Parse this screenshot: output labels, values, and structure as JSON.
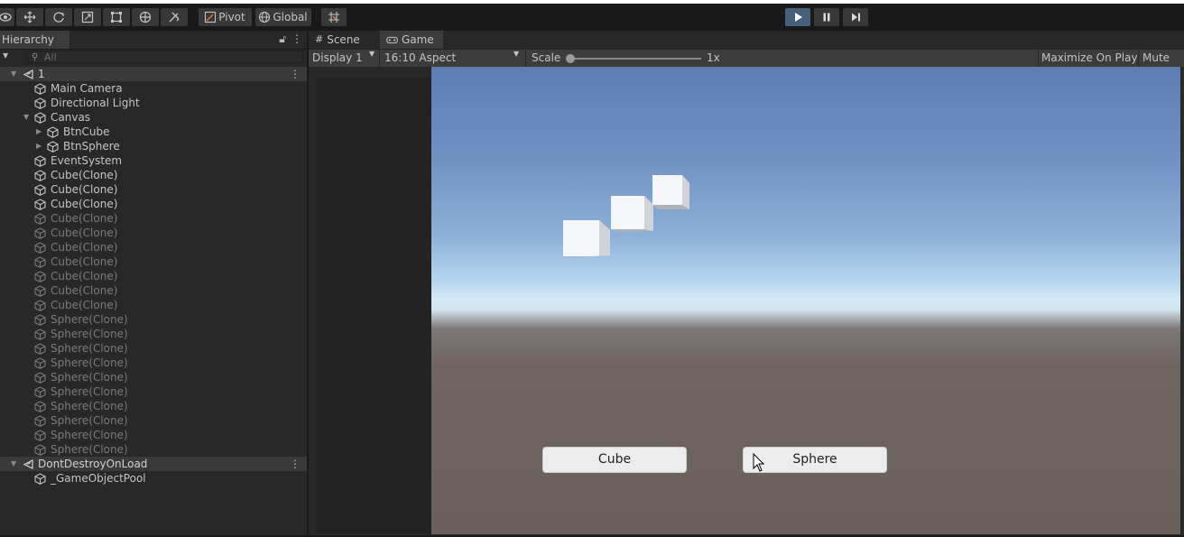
{
  "toolbar": {
    "pivot_label": "Pivot",
    "global_label": "Global",
    "tools": [
      "view-tool",
      "move-tool",
      "rotate-tool",
      "scale-tool",
      "rect-tool",
      "transform-tool",
      "custom-tool"
    ],
    "play_active": true
  },
  "hierarchy": {
    "tab_label": "Hierarchy",
    "search_placeholder": "All",
    "items": [
      {
        "label": "1",
        "type": "scene",
        "depth": 0
      },
      {
        "label": "Main Camera",
        "type": "object",
        "depth": 1
      },
      {
        "label": "Directional Light",
        "type": "object",
        "depth": 1
      },
      {
        "label": "Canvas",
        "type": "object",
        "depth": 1,
        "expanded": true
      },
      {
        "label": "BtnCube",
        "type": "object",
        "depth": 2,
        "collapsed": true
      },
      {
        "label": "BtnSphere",
        "type": "object",
        "depth": 2,
        "collapsed": true
      },
      {
        "label": "EventSystem",
        "type": "object",
        "depth": 1
      },
      {
        "label": "Cube(Clone)",
        "type": "object",
        "depth": 1
      },
      {
        "label": "Cube(Clone)",
        "type": "object",
        "depth": 1
      },
      {
        "label": "Cube(Clone)",
        "type": "object",
        "depth": 1
      },
      {
        "label": "Cube(Clone)",
        "type": "object",
        "depth": 1,
        "inactive": true
      },
      {
        "label": "Cube(Clone)",
        "type": "object",
        "depth": 1,
        "inactive": true
      },
      {
        "label": "Cube(Clone)",
        "type": "object",
        "depth": 1,
        "inactive": true
      },
      {
        "label": "Cube(Clone)",
        "type": "object",
        "depth": 1,
        "inactive": true
      },
      {
        "label": "Cube(Clone)",
        "type": "object",
        "depth": 1,
        "inactive": true
      },
      {
        "label": "Cube(Clone)",
        "type": "object",
        "depth": 1,
        "inactive": true
      },
      {
        "label": "Cube(Clone)",
        "type": "object",
        "depth": 1,
        "inactive": true
      },
      {
        "label": "Sphere(Clone)",
        "type": "object",
        "depth": 1,
        "inactive": true
      },
      {
        "label": "Sphere(Clone)",
        "type": "object",
        "depth": 1,
        "inactive": true
      },
      {
        "label": "Sphere(Clone)",
        "type": "object",
        "depth": 1,
        "inactive": true
      },
      {
        "label": "Sphere(Clone)",
        "type": "object",
        "depth": 1,
        "inactive": true
      },
      {
        "label": "Sphere(Clone)",
        "type": "object",
        "depth": 1,
        "inactive": true
      },
      {
        "label": "Sphere(Clone)",
        "type": "object",
        "depth": 1,
        "inactive": true
      },
      {
        "label": "Sphere(Clone)",
        "type": "object",
        "depth": 1,
        "inactive": true
      },
      {
        "label": "Sphere(Clone)",
        "type": "object",
        "depth": 1,
        "inactive": true
      },
      {
        "label": "Sphere(Clone)",
        "type": "object",
        "depth": 1,
        "inactive": true
      },
      {
        "label": "Sphere(Clone)",
        "type": "object",
        "depth": 1,
        "inactive": true
      },
      {
        "label": "DontDestroyOnLoad",
        "type": "scene",
        "depth": 0
      },
      {
        "label": "_GameObjectPool",
        "type": "object",
        "depth": 1
      }
    ]
  },
  "game": {
    "tabs": [
      {
        "label": "Scene",
        "icon": "grid-icon"
      },
      {
        "label": "Game",
        "icon": "gamepad-icon"
      }
    ],
    "display": "Display 1",
    "aspect": "16:10 Aspect",
    "scale_label": "Scale",
    "scale_value": "1x",
    "maximize_label": "Maximize On Play",
    "mute_label": "Mute Au",
    "buttons": {
      "cube": "Cube",
      "sphere": "Sphere"
    }
  }
}
